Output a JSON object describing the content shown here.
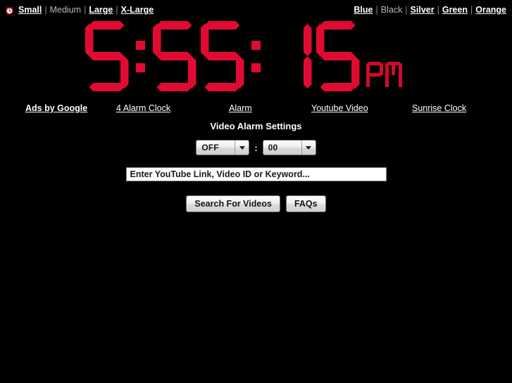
{
  "page": {
    "background_color": "#000000",
    "led_color": "#e10b31",
    "text_color": "#ffffff"
  },
  "topbar": {
    "favicon_name": "alarm-clock-icon",
    "size_nav": [
      {
        "label": "Small",
        "current": false
      },
      {
        "label": "Medium",
        "current": true
      },
      {
        "label": "Large",
        "current": false
      },
      {
        "label": "X-Large",
        "current": false
      }
    ],
    "color_nav": [
      {
        "label": "Blue",
        "current": false
      },
      {
        "label": "Black",
        "current": true
      },
      {
        "label": "Silver",
        "current": false
      },
      {
        "label": "Green",
        "current": false
      },
      {
        "label": "Orange",
        "current": false
      }
    ],
    "separator": "|"
  },
  "clock": {
    "time_text": "5:55:15",
    "hours": "5",
    "minutes": "55",
    "seconds": "15",
    "meridiem": "PM",
    "separator": ":"
  },
  "ad_links": [
    {
      "label": "Ads by Google",
      "bold": true
    },
    {
      "label": "4 Alarm Clock",
      "bold": false
    },
    {
      "label": "Alarm",
      "bold": false
    },
    {
      "label": "Youtube Video",
      "bold": false
    },
    {
      "label": "Sunrise Clock",
      "bold": false
    }
  ],
  "settings": {
    "title": "Video Alarm Settings",
    "hour_select": {
      "value": "OFF"
    },
    "time_separator": ":",
    "minute_select": {
      "value": "00"
    },
    "search": {
      "value": "Enter YouTube Link, Video ID or Keyword...",
      "placeholder": "Enter YouTube Link, Video ID or Keyword..."
    },
    "search_button": "Search For Videos",
    "faq_button": "FAQs"
  }
}
